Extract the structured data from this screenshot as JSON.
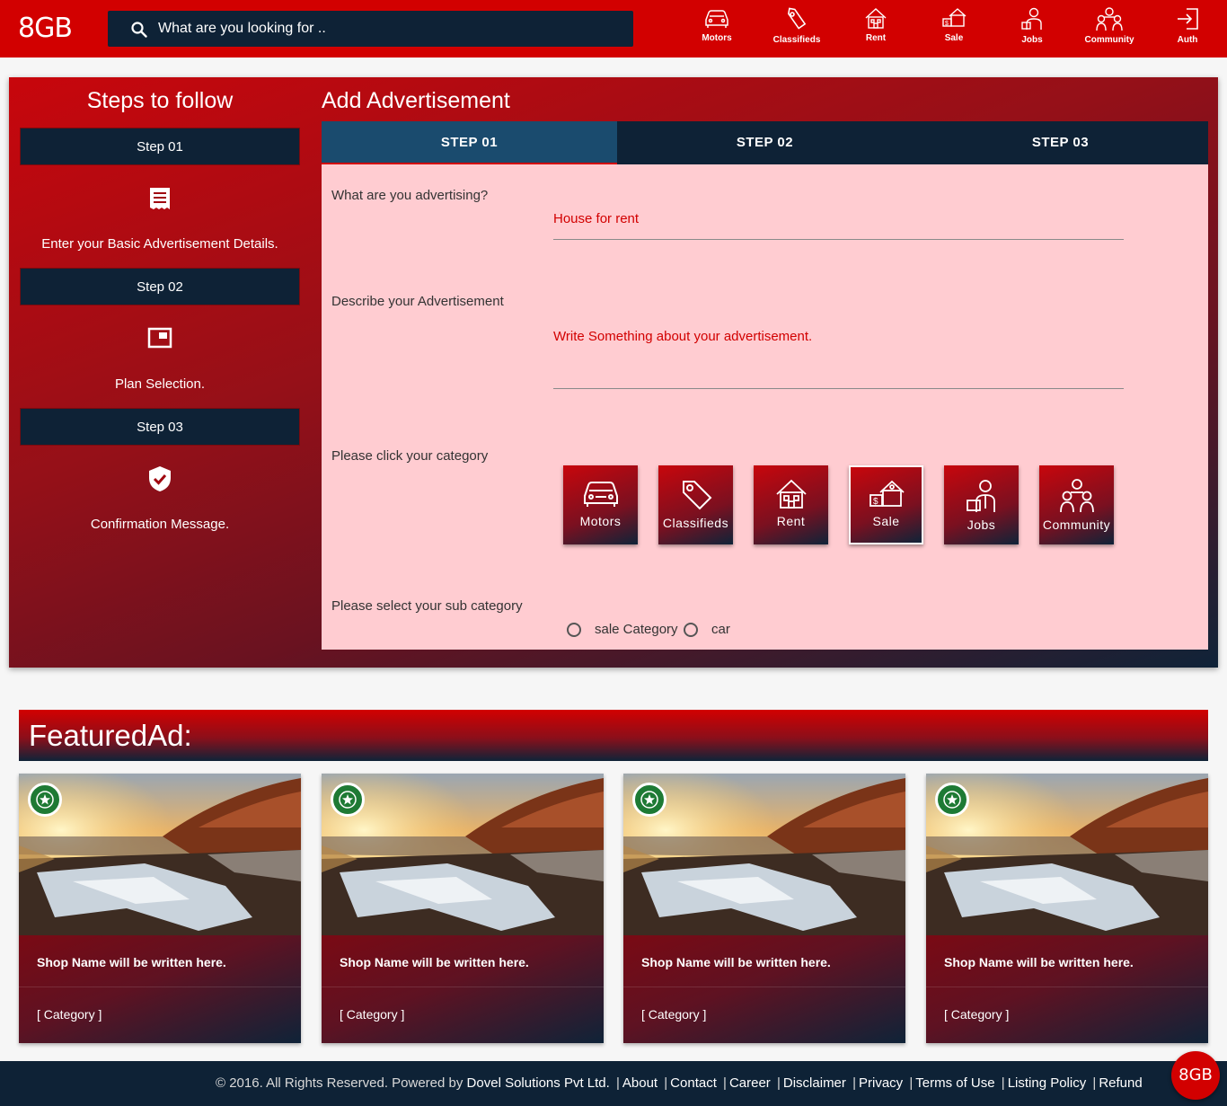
{
  "header": {
    "logo": "8GB",
    "search_placeholder": "What are you looking for ..",
    "nav": [
      {
        "label": "Motors",
        "icon": "car-icon"
      },
      {
        "label": "Classifieds",
        "icon": "tag-icon"
      },
      {
        "label": "Rent",
        "icon": "house-icon"
      },
      {
        "label": "Sale",
        "icon": "sale-house-icon"
      },
      {
        "label": "Jobs",
        "icon": "worker-icon"
      },
      {
        "label": "Community",
        "icon": "people-icon"
      },
      {
        "label": "Auth",
        "icon": "login-icon"
      }
    ]
  },
  "steps_panel": {
    "title": "Steps to follow",
    "steps": [
      {
        "label": "Step 01",
        "text": "Enter your Basic Advertisement Details.",
        "icon": "receipt-icon"
      },
      {
        "label": "Step 02",
        "text": "Plan Selection.",
        "icon": "picture-in-picture-icon"
      },
      {
        "label": "Step 03",
        "text": "Confirmation Message.",
        "icon": "verified-shield-icon"
      }
    ]
  },
  "form": {
    "title": "Add Advertisement",
    "tabs": [
      "STEP 01",
      "STEP 02",
      "STEP 03"
    ],
    "active_tab": "STEP 01",
    "what_label": "What are you advertising?",
    "what_value": "House for rent",
    "describe_label": "Describe your Advertisement",
    "describe_value": "Write Something about your advertisement.",
    "category_label": "Please click your category",
    "categories": [
      "Motors",
      "Classifieds",
      "Rent",
      "Sale",
      "Jobs",
      "Community"
    ],
    "selected_category": "Sale",
    "subcategory_label": "Please select your sub category",
    "subcategories": [
      "sale Category",
      "car"
    ]
  },
  "featured": {
    "title": "FeaturedAd:",
    "cards": [
      {
        "shop": "Shop Name will be written here.",
        "category": "[ Category ]"
      },
      {
        "shop": "Shop Name will be written here.",
        "category": "[ Category ]"
      },
      {
        "shop": "Shop Name will be written here.",
        "category": "[ Category ]"
      },
      {
        "shop": "Shop Name will be written here.",
        "category": "[ Category ]"
      }
    ]
  },
  "footer": {
    "copyright": "© 2016. All Rights Reserved. Powered by",
    "company": "Dovel Solutions Pvt Ltd.",
    "links": [
      "About",
      "Contact",
      "Career",
      "Disclaimer",
      "Privacy",
      "Terms of Use",
      "Listing Policy",
      "Refund"
    ],
    "fab": "8GB"
  },
  "colors": {
    "brand_red": "#d20000",
    "navy": "#0e2236",
    "form_bg": "#ffccd1",
    "badge_green": "#1e7a34"
  }
}
